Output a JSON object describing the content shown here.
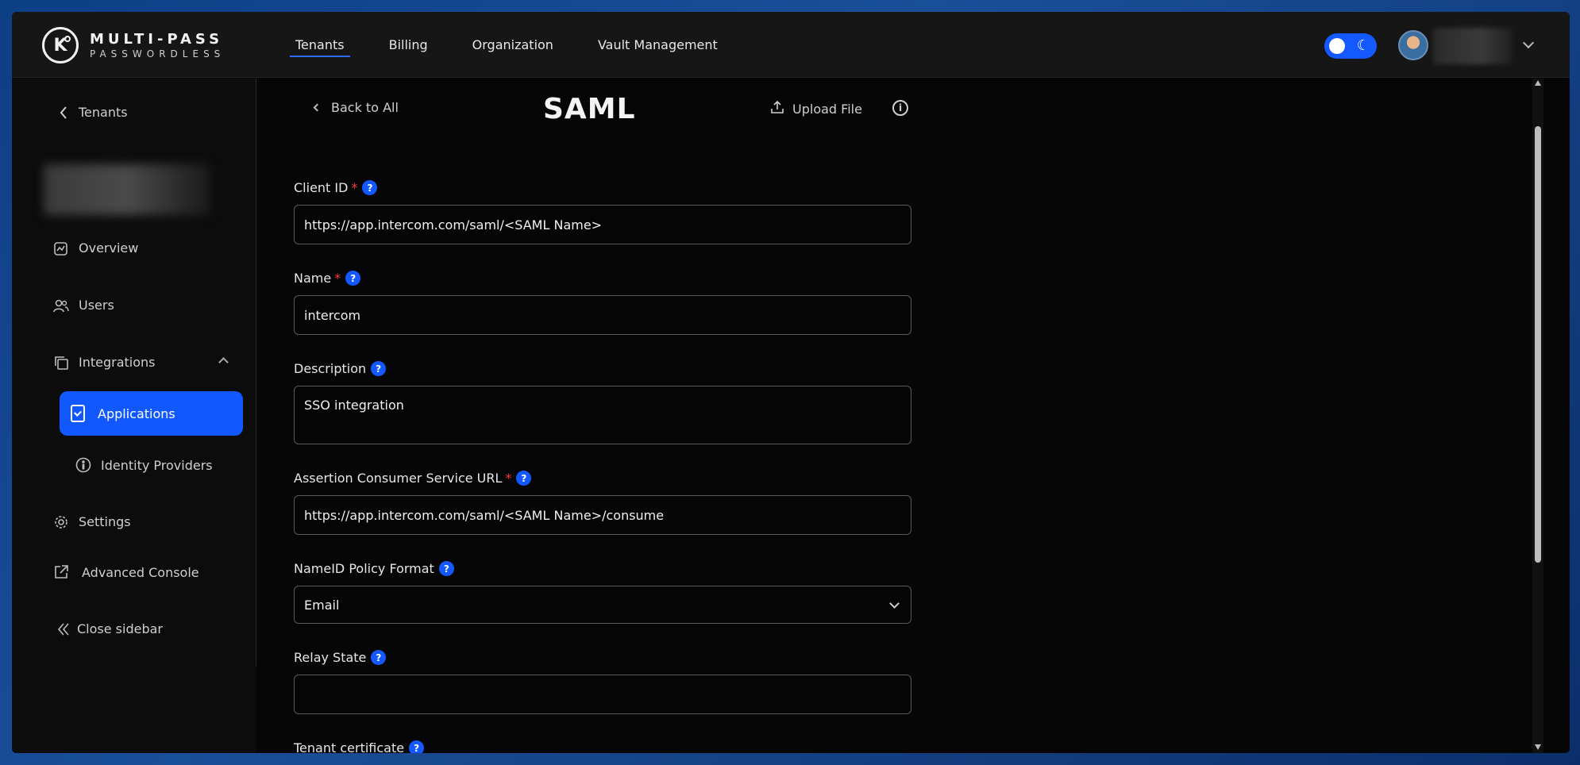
{
  "brand": {
    "line1": "MULTI-PASS",
    "line2": "PASSWORDLESS",
    "mark": "K"
  },
  "nav": [
    {
      "label": "Tenants",
      "active": true
    },
    {
      "label": "Billing",
      "active": false
    },
    {
      "label": "Organization",
      "active": false
    },
    {
      "label": "Vault Management",
      "active": false
    }
  ],
  "theme_toggle": {
    "moon": "☾"
  },
  "sidebar": {
    "back_label": "Tenants",
    "items": {
      "overview": "Overview",
      "users": "Users",
      "integrations": "Integrations",
      "applications": "Applications",
      "identity_providers": "Identity Providers",
      "settings": "Settings",
      "advanced_console": "Advanced Console",
      "close_sidebar": "Close sidebar"
    }
  },
  "header": {
    "back": "Back to All",
    "title": "SAML",
    "upload": "Upload File"
  },
  "form": {
    "client_id": {
      "label": "Client ID",
      "value": "https://app.intercom.com/saml/<SAML Name>"
    },
    "name": {
      "label": "Name",
      "value": "intercom"
    },
    "description": {
      "label": "Description",
      "value": "SSO integration"
    },
    "acs_url": {
      "label": "Assertion Consumer Service URL",
      "value": "https://app.intercom.com/saml/<SAML Name>/consume"
    },
    "nameid_format": {
      "label": "NameID Policy Format",
      "value": "Email"
    },
    "relay_state": {
      "label": "Relay State",
      "value": ""
    },
    "tenant_certificate": {
      "label": "Tenant certificate"
    }
  },
  "colors": {
    "accent": "#1458ff",
    "required": "#ff3b3b",
    "background": "#060606"
  }
}
